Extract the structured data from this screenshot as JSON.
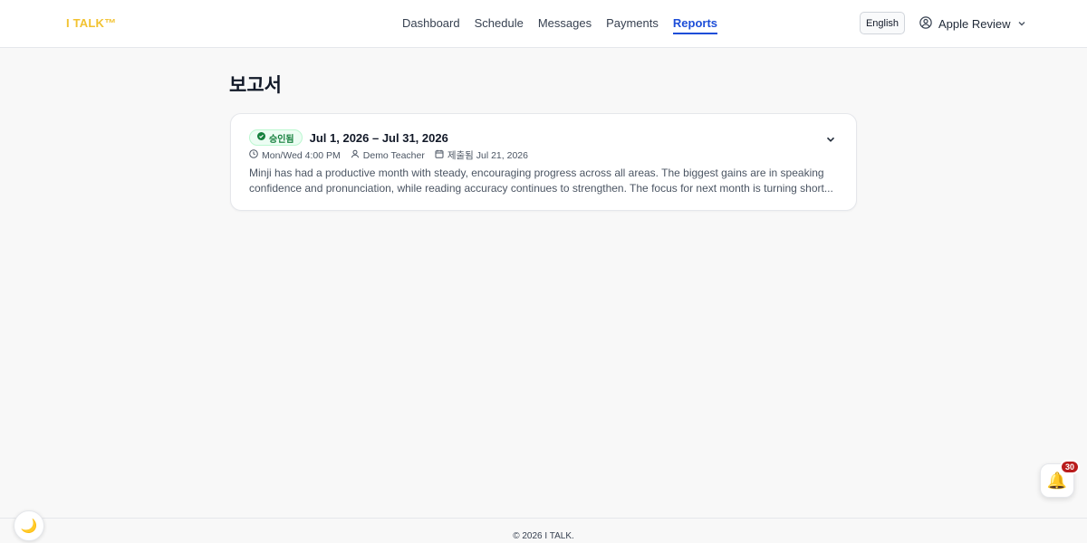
{
  "header": {
    "logo": "I TALK™",
    "nav": [
      {
        "label": "Dashboard",
        "active": false
      },
      {
        "label": "Schedule",
        "active": false
      },
      {
        "label": "Messages",
        "active": false
      },
      {
        "label": "Payments",
        "active": false
      },
      {
        "label": "Reports",
        "active": true
      }
    ],
    "language": "English",
    "user_name": "Apple Review",
    "user_icon": "user-circle-icon",
    "chevron_icon": "chevron-down-icon"
  },
  "page": {
    "title": "보고서"
  },
  "report": {
    "status": "승인됨",
    "status_icon": "check-circle-icon",
    "date_range": "Jul 1, 2026 – Jul 31, 2026",
    "schedule": "Mon/Wed 4:00 PM",
    "teacher": "Demo Teacher",
    "submitted": "제출됨 Jul 21, 2026",
    "summary": "Minji has had a productive month with steady, encouraging progress across all areas. The biggest gains are in speaking confidence and pronunciation, while reading accuracy continues to strengthen. The focus for next month is turning short..."
  },
  "notifications": {
    "count": "30",
    "icon": "bell-icon"
  },
  "footer": {
    "copyright": "© 2026 I TALK."
  },
  "theme_toggle": {
    "icon": "moon-icon"
  },
  "colors": {
    "accent": "#1d4ed8",
    "logo": "#f2c230",
    "approved": "#15803d",
    "badge_red": "#b91c1c"
  }
}
